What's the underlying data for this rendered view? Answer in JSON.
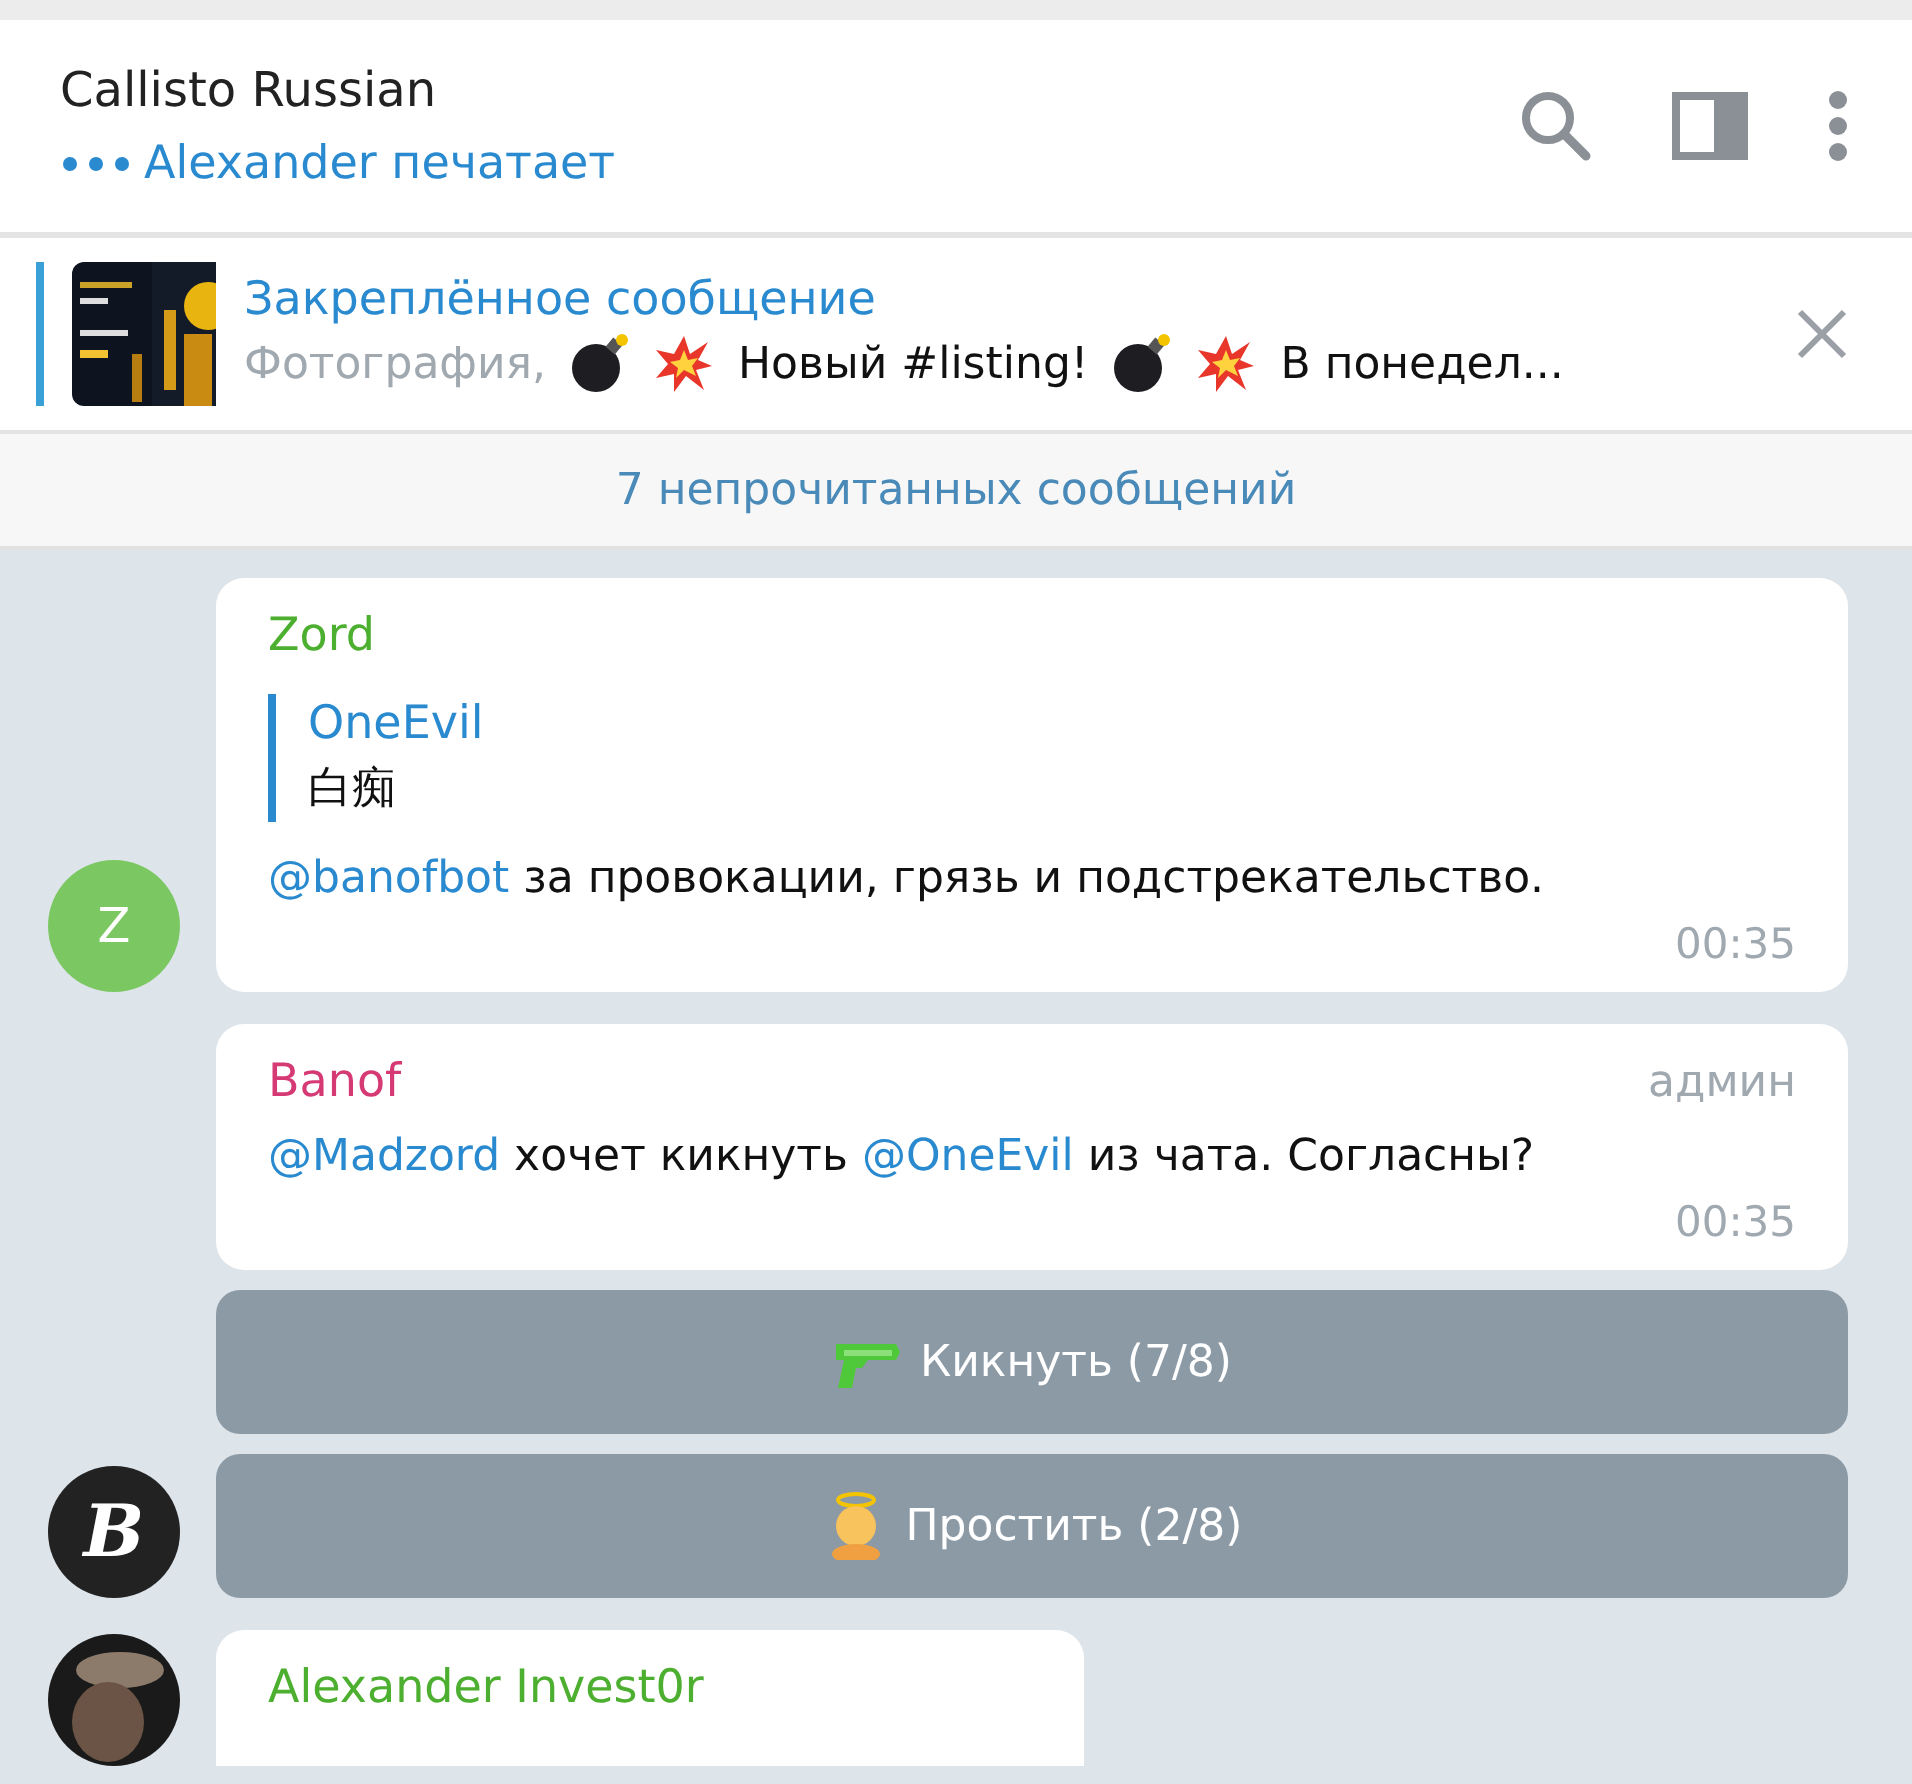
{
  "header": {
    "title": "Callisto Russian",
    "status": "Alexander печатает"
  },
  "pinned": {
    "title": "Закреплённое сообщение",
    "preview": [
      {
        "kind": "muted",
        "text": "Фотография,"
      },
      {
        "kind": "bomb"
      },
      {
        "kind": "boom"
      },
      {
        "kind": "text",
        "text": "Новый #listing!"
      },
      {
        "kind": "bomb"
      },
      {
        "kind": "boom"
      },
      {
        "kind": "text",
        "text": "В понедел..."
      }
    ]
  },
  "unread": "7 непрочитанных сообщений",
  "messages": [
    {
      "sender": "Zord",
      "color": "#4caf2f",
      "avatar": {
        "kind": "letter",
        "text": "Z",
        "color": "#7bc862"
      },
      "reply": {
        "author": "OneEvil",
        "text": "白痴"
      },
      "parts": [
        {
          "kind": "mention",
          "text": "@banofbot"
        },
        {
          "kind": "text",
          "text": " за провокации, грязь и подстрекательство."
        }
      ],
      "time": "00:35"
    },
    {
      "sender": "Banof",
      "color": "#d63a75",
      "badge": "админ",
      "parts": [
        {
          "kind": "mention",
          "text": "@Madzord"
        },
        {
          "kind": "text",
          "text": " хочет кикнуть "
        },
        {
          "kind": "mention",
          "text": "@OneEvil"
        },
        {
          "kind": "text",
          "text": " из чата. Согласны?"
        }
      ],
      "time": "00:35",
      "buttons": [
        {
          "kind": "gun",
          "label": "Кикнуть (7/8)"
        },
        {
          "kind": "angel",
          "label": "Простить (2/8)"
        }
      ],
      "avatar": {
        "kind": "logo",
        "text": "B",
        "color": "#222222"
      }
    },
    {
      "sender": "Alexander Invest0r",
      "color": "#4caf2f"
    }
  ]
}
